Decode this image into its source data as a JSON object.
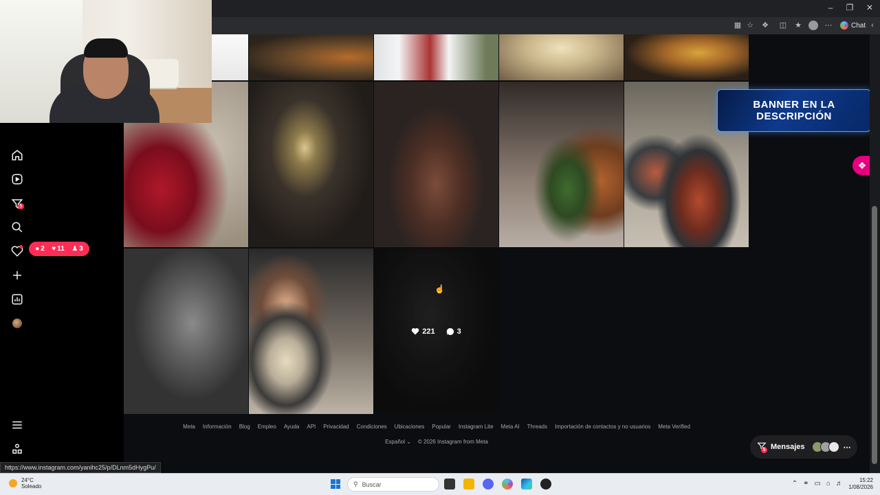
{
  "browser": {
    "chat_label": "Chat",
    "status_url": "https://www.instagram.com/yanihc25/p/DLnm5dHygPu/"
  },
  "sidebar": {
    "reels_badge": "5",
    "notifications": {
      "comments": "2",
      "likes": "11",
      "follows": "3"
    }
  },
  "grid": {
    "hover_post": {
      "likes": "221",
      "comments": "3"
    }
  },
  "banner": {
    "text": "BANNER EN LA DESCRIPCIÓN"
  },
  "footer": {
    "links": [
      "Meta",
      "Información",
      "Blog",
      "Empleo",
      "Ayuda",
      "API",
      "Privacidad",
      "Condiciones",
      "Ubicaciones",
      "Popular",
      "Instagram Lite",
      "Meta AI",
      "Threads",
      "Importación de contactos y no usuarios",
      "Meta Verified"
    ],
    "language": "Español",
    "copyright": "© 2026 Instagram from Meta"
  },
  "messages": {
    "label": "Mensajes",
    "badge": "5"
  },
  "taskbar": {
    "temperature": "24°C",
    "condition": "Soleado",
    "search_placeholder": "Buscar",
    "time": "15:22",
    "date": "1/08/2026"
  },
  "colors": {
    "accent": "#ff2d55",
    "banner": "#0e3a8c",
    "fab": "#e6007e"
  }
}
